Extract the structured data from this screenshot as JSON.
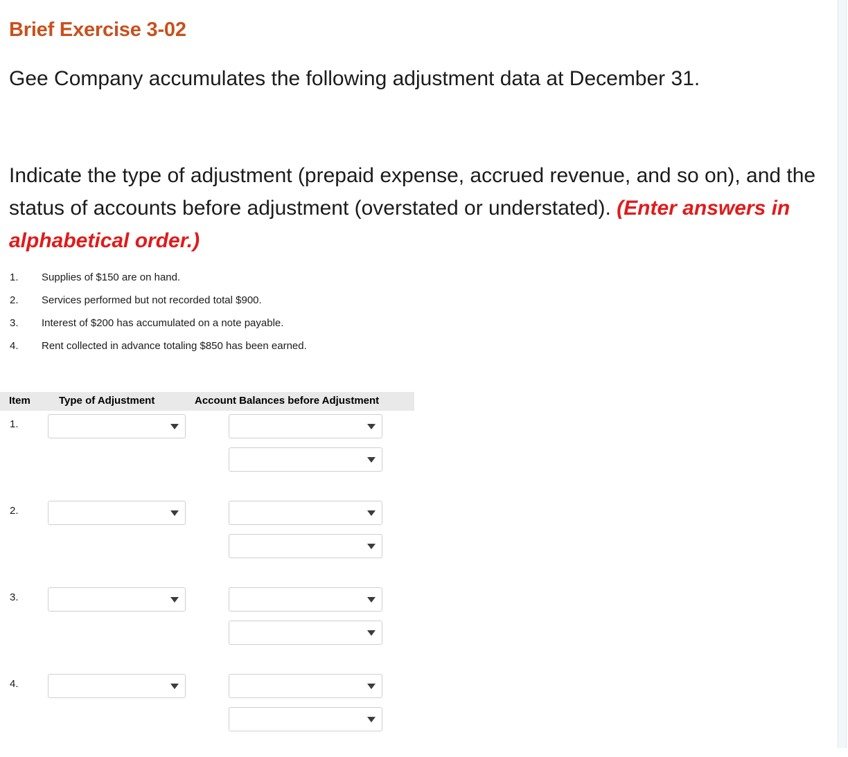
{
  "title": "Brief Exercise 3-02",
  "intro": "Gee Company accumulates the following adjustment data at December 31.",
  "instruction": {
    "main": "Indicate the type of adjustment (prepaid expense, accrued revenue, and so on), and the status of accounts before adjustment (overstated or understated).",
    "emphasis": "(Enter answers in alphabetical order.)"
  },
  "facts": [
    {
      "num": "1.",
      "text": "Supplies of $150 are on hand."
    },
    {
      "num": "2.",
      "text": "Services performed but not recorded total $900."
    },
    {
      "num": "3.",
      "text": "Interest of $200 has accumulated on a note payable."
    },
    {
      "num": "4.",
      "text": "Rent collected in advance totaling $850 has been earned."
    }
  ],
  "table": {
    "headers": {
      "item": "Item",
      "type": "Type of Adjustment",
      "balances": "Account Balances before Adjustment"
    },
    "rows": [
      {
        "num": "1.",
        "type_value": "",
        "balance_1": "",
        "balance_2": ""
      },
      {
        "num": "2.",
        "type_value": "",
        "balance_1": "",
        "balance_2": ""
      },
      {
        "num": "3.",
        "type_value": "",
        "balance_1": "",
        "balance_2": ""
      },
      {
        "num": "4.",
        "type_value": "",
        "balance_1": "",
        "balance_2": ""
      }
    ]
  },
  "icons": {
    "dropdown_arrow": "chevron-down-icon"
  },
  "colors": {
    "title": "#c9501d",
    "emphasis": "#e01b1b",
    "header_band": "#e9e9e9",
    "select_border": "#cfcfcf",
    "scrollbar_track": "#f2f7f9"
  }
}
